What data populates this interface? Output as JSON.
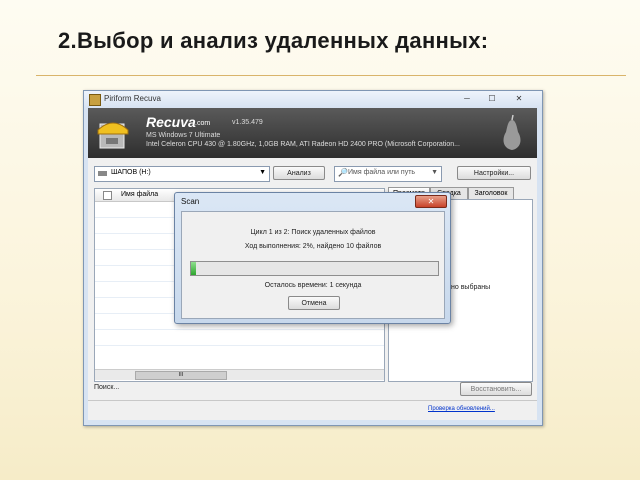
{
  "slide": {
    "title": "2.Выбор и анализ удаленных данных:"
  },
  "window": {
    "title": "Piriform Recuva",
    "controls": [
      "─",
      "☐",
      "✕"
    ]
  },
  "header": {
    "brand": "Recuva",
    "brand_suffix": ".com",
    "version": "v1.35.479",
    "os": "MS Windows 7 Ultimate",
    "hardware": "Intel Celeron CPU 430 @ 1.80GHz, 1,0GB RAM, ATI Radeon HD 2400 PRO (Microsoft Corporation..."
  },
  "toolbar": {
    "drive": "ШАПОВ (H:)",
    "analyze_label": "Анализ",
    "path_placeholder": "Имя файла или путь",
    "settings_label": "Настройки..."
  },
  "file_list": {
    "column": "Имя файла",
    "scroll_label": "III"
  },
  "tabs": [
    "Просмотр",
    "Сводка",
    "Заголовок"
  ],
  "panel": {
    "text": "но выбраны"
  },
  "status": {
    "text": "Поиск...",
    "recover_label": "Восстановить...",
    "update_link": "Проверка обновлений..."
  },
  "scan_dialog": {
    "title": "Scan",
    "close": "✕",
    "stage": "Цикл 1 из 2: Поиск удаленных файлов",
    "progress_text": "Ход выполнения: 2%, найдено 10 файлов",
    "progress_percent": 2,
    "remaining": "Осталось времени: 1 секунда",
    "cancel_label": "Отмена"
  },
  "colors": {
    "slide_bg": "#fbf4dc",
    "title_rule": "#d9b46a",
    "progress_fill": "#2ea62e",
    "link": "#0033cc"
  }
}
